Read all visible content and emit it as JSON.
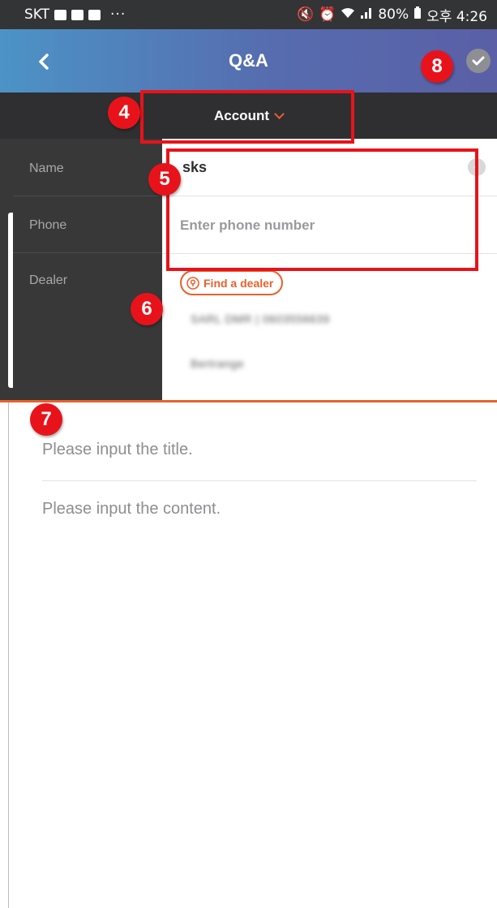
{
  "status_bar": {
    "carrier": "SKT",
    "more": "···",
    "battery": "80%",
    "time": "오후 4:26"
  },
  "header": {
    "title": "Q&A",
    "back_icon": "chevron-left-icon",
    "submit_icon": "check-icon"
  },
  "category": {
    "selected": "Account"
  },
  "form": {
    "labels": {
      "name": "Name",
      "phone": "Phone",
      "dealer": "Dealer"
    },
    "name_value": "sks",
    "phone_placeholder": "Enter phone number",
    "find_dealer_label": "Find a dealer",
    "dealer_line1": "SARL DMR | 0603556639",
    "dealer_line2": "Bertrange"
  },
  "post": {
    "title_placeholder": "Please input the title.",
    "content_placeholder": "Please input the content."
  },
  "annotations": {
    "marker_4": "4",
    "marker_5": "5",
    "marker_6": "6",
    "marker_7": "7",
    "marker_8": "8"
  },
  "colors": {
    "accent": "#e8612c",
    "header_gradient_start": "#4c93c6",
    "header_gradient_end": "#5a5fa6",
    "annotation_red": "#e8131a",
    "dark_panel": "#383839"
  }
}
